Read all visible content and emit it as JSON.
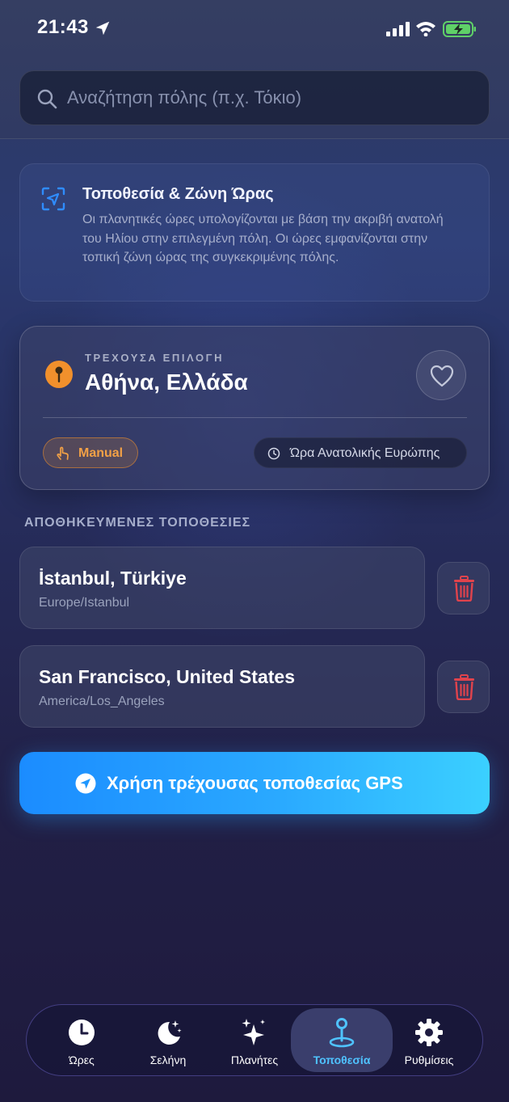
{
  "status_bar": {
    "time": "21:43"
  },
  "search": {
    "placeholder": "Αναζήτηση πόλης (π.χ. Τόκιο)"
  },
  "info_card": {
    "icon": "location-scan-icon",
    "title": "Τοποθεσία & Ζώνη Ώρας",
    "description": "Οι πλανητικές ώρες υπολογίζονται με βάση την ακριβή ανατολή του Ηλίου στην επιλεγμένη πόλη. Οι ώρες εμφανίζονται στην τοπική ζώνη ώρας της συγκεκριμένης πόλης."
  },
  "current_selection": {
    "label": "ΤΡΕΧΟΥΣΑ ΕΠΙΛΟΓΗ",
    "city": "Αθήνα, Ελλάδα",
    "mode_badge": "Manual",
    "timezone_badge": "Ώρα Ανατολικής Ευρώπης",
    "accent_color": "#f1902c"
  },
  "saved_locations": {
    "heading": "ΑΠΟΘΗΚΕΥΜΕΝΕΣ ΤΟΠΟΘΕΣΙΕΣ",
    "items": [
      {
        "name": "İstanbul, Türkiye",
        "timezone": "Europe/Istanbul"
      },
      {
        "name": "San Francisco, United States",
        "timezone": "America/Los_Angeles"
      }
    ],
    "delete_color": "#e0434c"
  },
  "gps_button": {
    "label": "Χρήση τρέχουσας τοποθεσίας GPS"
  },
  "tab_bar": {
    "active_color": "#4fc3ff",
    "tabs": [
      {
        "label": "Ώρες",
        "icon": "clock-icon"
      },
      {
        "label": "Σελήνη",
        "icon": "moon-stars-icon"
      },
      {
        "label": "Πλανήτες",
        "icon": "sparkles-icon"
      },
      {
        "label": "Τοποθεσία",
        "icon": "location-pin-icon",
        "active": true
      },
      {
        "label": "Ρυθμίσεις",
        "icon": "gear-icon"
      }
    ]
  }
}
